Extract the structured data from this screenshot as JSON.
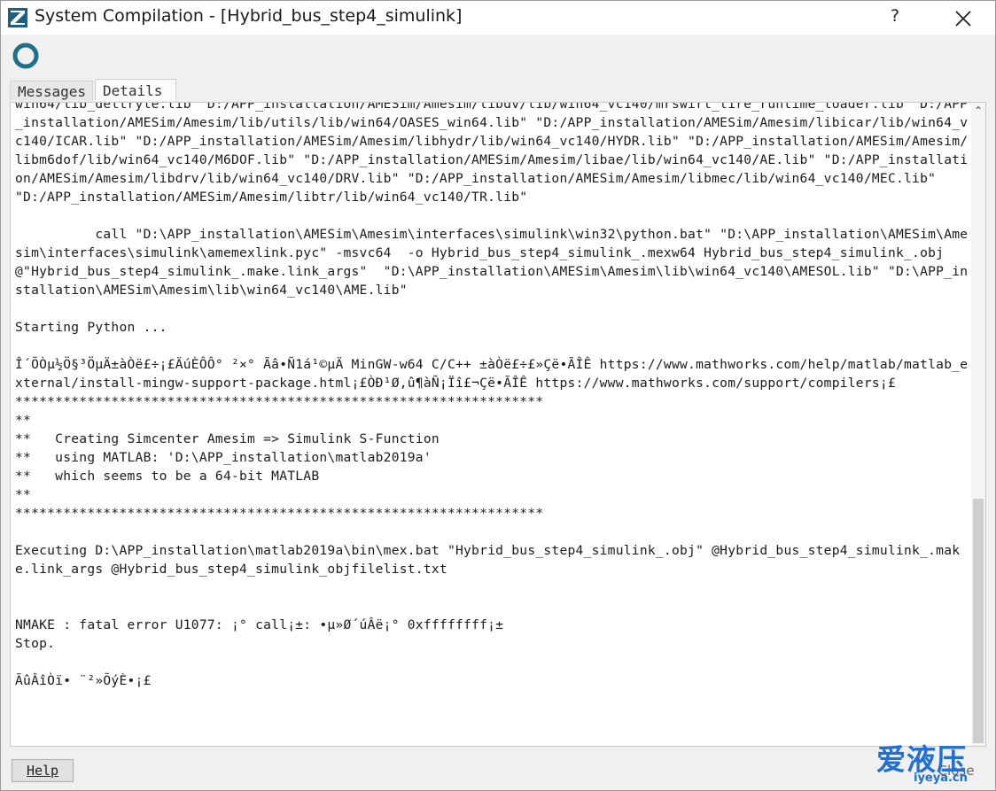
{
  "window": {
    "title": "System Compilation - [Hybrid_bus_step4_simulink]",
    "help_symbol": "?",
    "accent_color": "#1f6f8b"
  },
  "tabs": [
    {
      "label": "Messages",
      "selected": false
    },
    {
      "label": "Details",
      "selected": true
    }
  ],
  "log_text": "win64/lib_deltryle.lib  D:/APP_installation/AMESim/Amesim/libdv/lib/win64_vc140/mrswirt_tire_runtime_loader.lib  D:/APP_installation/AMESim/Amesim/lib/utils/lib/win64/OASES_win64.lib\" \"D:/APP_installation/AMESim/Amesim/libicar/lib/win64_vc140/ICAR.lib\" \"D:/APP_installation/AMESim/Amesim/libhydr/lib/win64_vc140/HYDR.lib\" \"D:/APP_installation/AMESim/Amesim/libm6dof/lib/win64_vc140/M6DOF.lib\" \"D:/APP_installation/AMESim/Amesim/libae/lib/win64_vc140/AE.lib\" \"D:/APP_installation/AMESim/Amesim/libdrv/lib/win64_vc140/DRV.lib\" \"D:/APP_installation/AMESim/Amesim/libmec/lib/win64_vc140/MEC.lib\" \"D:/APP_installation/AMESim/Amesim/libtr/lib/win64_vc140/TR.lib\"\n\n          call \"D:\\APP_installation\\AMESim\\Amesim\\interfaces\\simulink\\win32\\python.bat\" \"D:\\APP_installation\\AMESim\\Amesim\\interfaces\\simulink\\amemexlink.pyc\" -msvc64  -o Hybrid_bus_step4_simulink_.mexw64 Hybrid_bus_step4_simulink_.obj @\"Hybrid_bus_step4_simulink_.make.link_args\"  \"D:\\APP_installation\\AMESim\\Amesim\\lib\\win64_vc140\\AMESOL.lib\" \"D:\\APP_installation\\AMESim\\Amesim\\lib\\win64_vc140\\AME.lib\"\n\nStarting Python ...\n\nÎ´ÕÒµ½Ö§³ÖµÄ±àÒë£÷¡£ÄúÈÔÔ° ²×° Ãâ•Ñ1á¹©µÄ MinGW-w64 C/C++ ±àÒë£÷£»Çë•ÃÎÊ https://www.mathworks.com/help/matlab/matlab_external/install-mingw-support-package.html¡£ÒÐ¹Ø,û¶àÑ¡Ïî£¬Çë•ÃÎÊ https://www.mathworks.com/support/compilers¡£\n******************************************************************\n**\n**   Creating Simcenter Amesim => Simulink S-Function\n**   using MATLAB: 'D:\\APP_installation\\matlab2019a'\n**   which seems to be a 64-bit MATLAB\n**\n******************************************************************\n\nExecuting D:\\APP_installation\\matlab2019a\\bin\\mex.bat \"Hybrid_bus_step4_simulink_.obj\" @Hybrid_bus_step4_simulink_.make.link_args @Hybrid_bus_step4_simulink_objfilelist.txt\n\n\nNMAKE : fatal error U1077: ¡° call¡±: •µ»Ø´úÂë¡° 0xffffffff¡±\nStop.\n\nÃûÂîÒï• ¨²»ÕýÈ•¡£",
  "footer": {
    "help_label": "Help",
    "close_label": "Close"
  },
  "watermark": {
    "text": "爱液压",
    "url": "iyeya.cn"
  }
}
